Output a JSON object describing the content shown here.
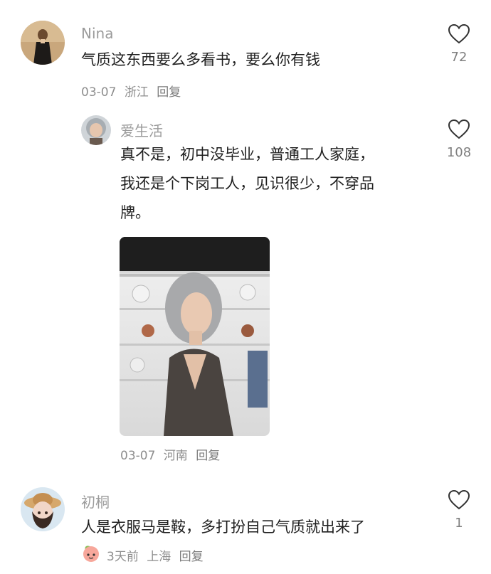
{
  "comments": [
    {
      "username": "Nina",
      "text": "气质这东西要么多看书，要么你有钱",
      "date": "03-07",
      "location": "浙江",
      "reply_label": "回复",
      "likes": "72",
      "avatar_icon": "user-avatar-photo"
    },
    {
      "username": "爱生活",
      "text_lines": [
        "真不是，初中没毕业，普通工人家庭，",
        "我还是个下岗工人，见识很少，不穿品",
        "牌。"
      ],
      "date": "03-07",
      "location": "河南",
      "reply_label": "回复",
      "likes": "108",
      "avatar_icon": "user-avatar-photo",
      "image": "attached-photo-woman-gray-hair"
    },
    {
      "username": "初桐",
      "text": "人是衣服马是鞍，多打扮自己气质就出来了",
      "date": "3天前",
      "location": "上海",
      "reply_label": "回复",
      "likes": "1",
      "avatar_icon": "user-avatar-illustration",
      "badge_icon": "peach-badge-icon"
    }
  ],
  "colors": {
    "username": "#9b9b9b",
    "meta": "#8e8e8e",
    "text": "#1f1f1f",
    "icon": "#333333"
  }
}
